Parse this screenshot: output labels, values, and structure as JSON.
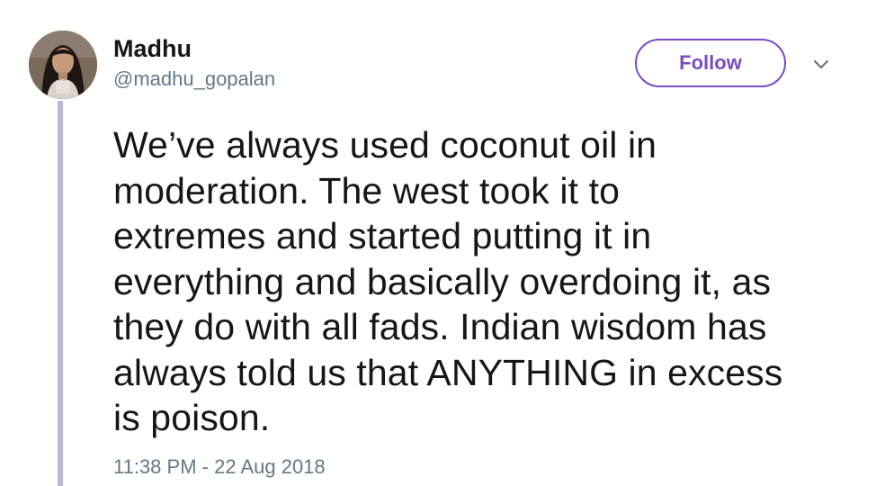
{
  "author": {
    "name": "Madhu",
    "handle": "@madhu_gopalan"
  },
  "follow_button": {
    "label": "Follow"
  },
  "menu": {
    "icon": "chevron-down-icon"
  },
  "tweet": {
    "lines": [
      "We’ve always used coconut oil in",
      "moderation. The west took it to",
      "extremes and started putting it in",
      "everything and basically overdoing it, as",
      "they do with all fads. Indian wisdom has",
      "always told us that ANYTHING in excess",
      "is poison."
    ],
    "timestamp": "11:38 PM - 22 Aug 2018"
  },
  "colors": {
    "accent": "#794bc4",
    "thread_line": "#c4b6d9",
    "text": "#14171a",
    "secondary": "#657786"
  }
}
